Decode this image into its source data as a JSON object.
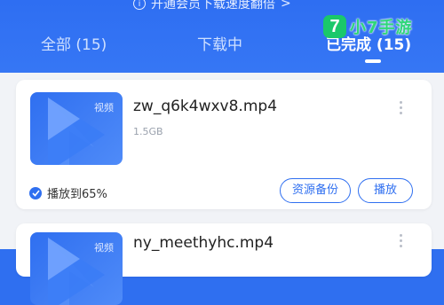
{
  "promo": {
    "text": "开通会员下载速度翻倍",
    "chevron": ">"
  },
  "tabs": [
    {
      "label": "全部 (15)"
    },
    {
      "label": "下载中"
    },
    {
      "label": "已完成 (15)"
    }
  ],
  "logo": {
    "badge": "7",
    "text": "小7手游"
  },
  "items": [
    {
      "thumb_badge": "视频",
      "filename": "zw_q6k4wxv8.mp4",
      "size": "1.5GB",
      "progress_text": "播放到65%",
      "backup_label": "资源备份",
      "play_label": "播放"
    },
    {
      "thumb_badge": "视频",
      "filename": "ny_meethyhc.mp4"
    }
  ],
  "colors": {
    "accent": "#2f6ff0",
    "brand_green": "#1ac86a"
  }
}
